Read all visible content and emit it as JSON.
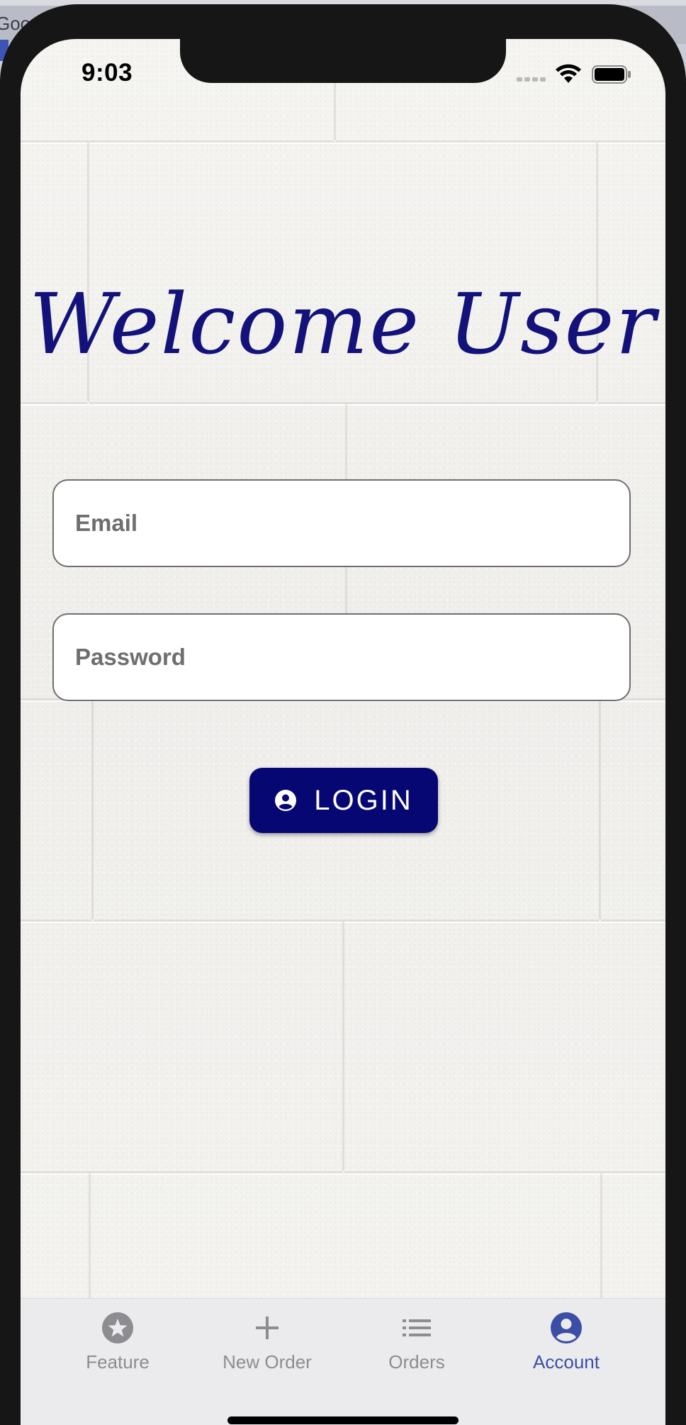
{
  "background_app": {
    "partial_text": "Goog"
  },
  "status_bar": {
    "time": "9:03",
    "signal_icon": "cellular-signal-icon",
    "wifi_icon": "wifi-icon",
    "battery_icon": "battery-icon"
  },
  "header": {
    "title": "Welcome User",
    "title_color": "#13127a"
  },
  "form": {
    "email": {
      "placeholder": "Email",
      "value": ""
    },
    "password": {
      "placeholder": "Password",
      "value": ""
    },
    "login_button": {
      "label": "LOGIN",
      "icon": "account-circle-icon",
      "color": "#070773"
    }
  },
  "tab_bar": {
    "active_color": "#3c4da6",
    "inactive_color": "#8d8d91",
    "tabs": [
      {
        "label": "Feature",
        "icon": "star-circle-icon",
        "active": false
      },
      {
        "label": "New Order",
        "icon": "plus-icon",
        "active": false
      },
      {
        "label": "Orders",
        "icon": "list-icon",
        "active": false
      },
      {
        "label": "Account",
        "icon": "account-circle-icon",
        "active": true
      }
    ]
  }
}
